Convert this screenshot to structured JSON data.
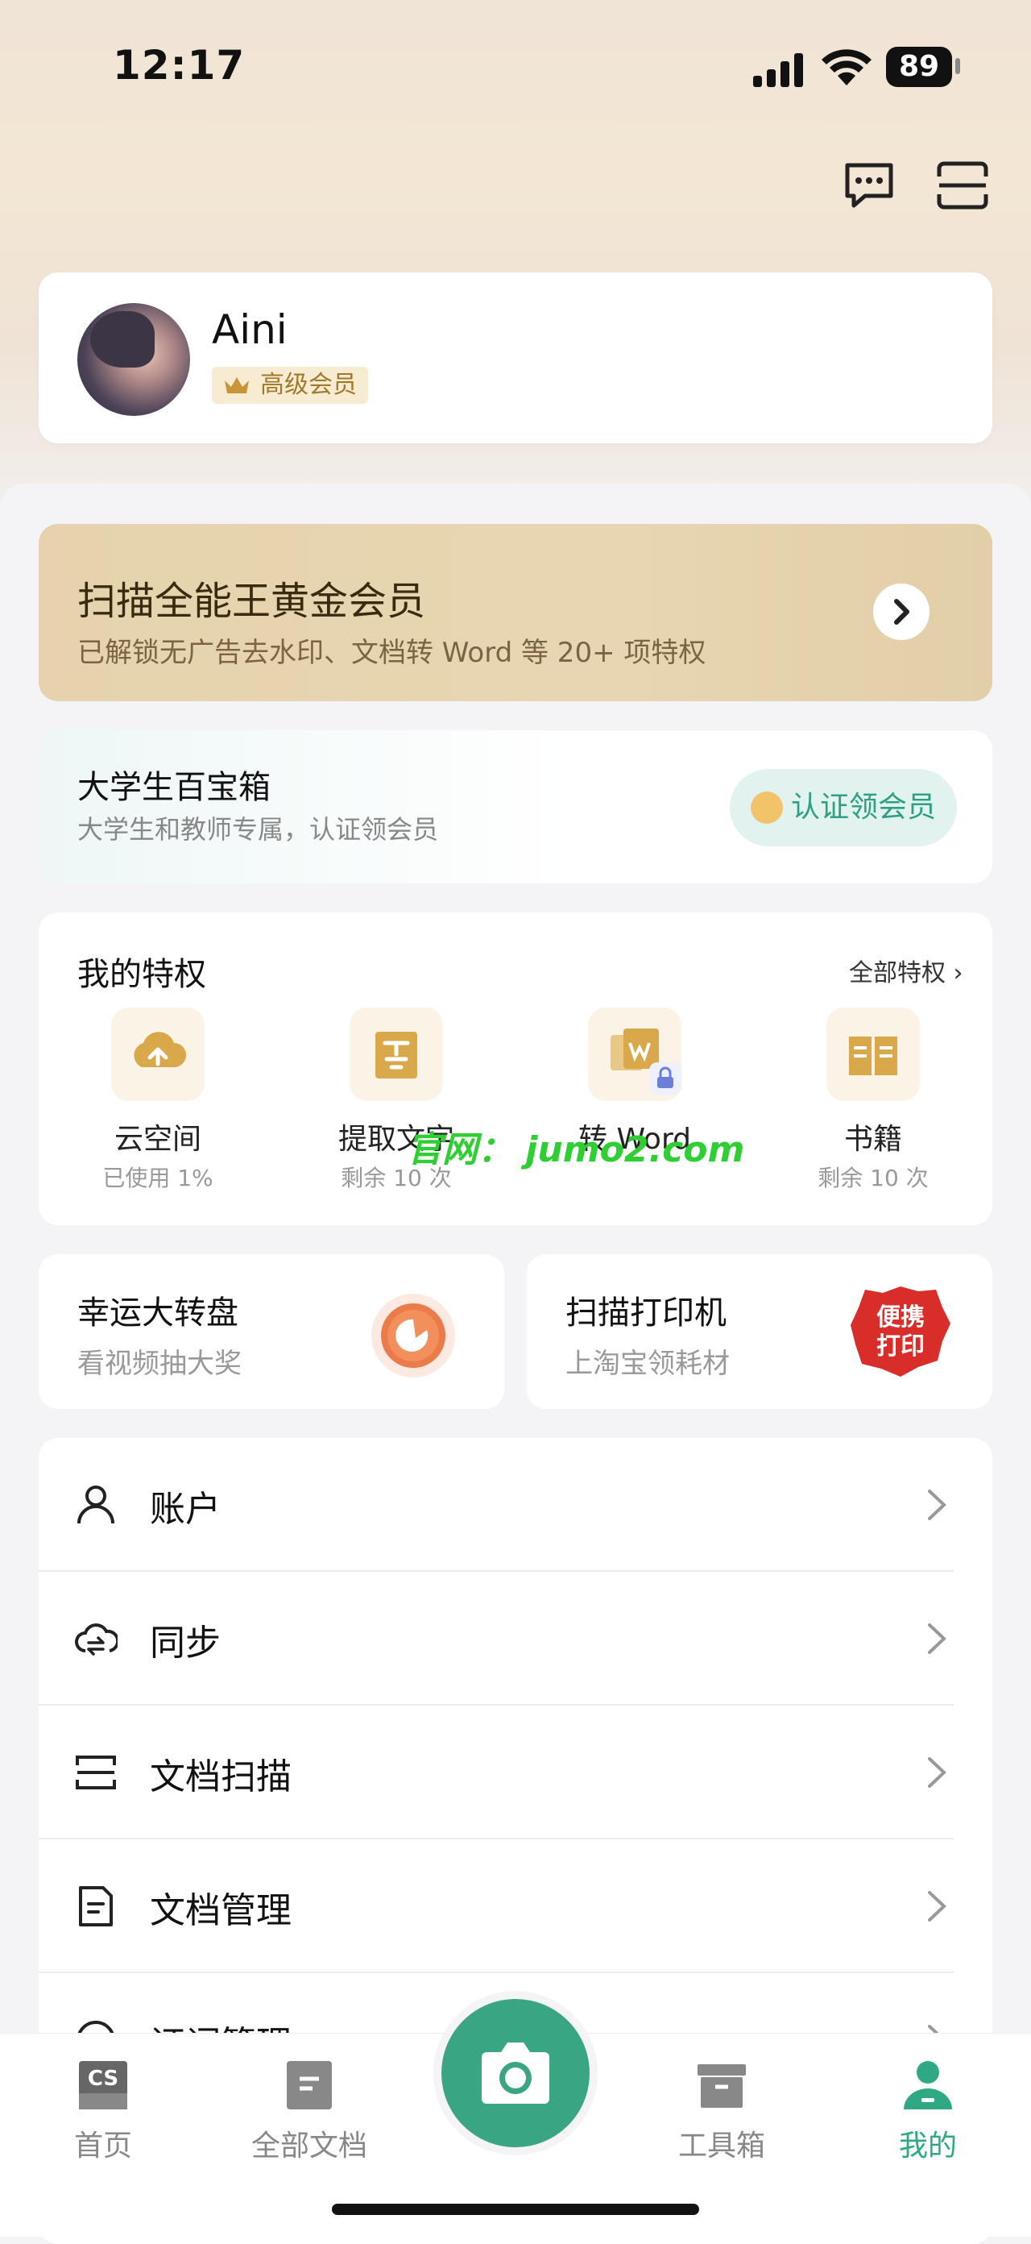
{
  "status_bar": {
    "time": "12:17",
    "battery": "89"
  },
  "header": {
    "message_icon": "chat-bubble-icon",
    "scan_icon": "scan-icon"
  },
  "profile": {
    "name": "Aini",
    "badge": "高级会员"
  },
  "gold_card": {
    "title": "扫描全能王黄金会员",
    "subtitle": "已解锁无广告去水印、文档转 Word 等 20+ 项特权"
  },
  "student_card": {
    "title": "大学生百宝箱",
    "subtitle": "大学生和教师专属，认证领会员",
    "button": "认证领会员"
  },
  "privileges": {
    "title": "我的特权",
    "all_link": "全部特权 ›",
    "items": [
      {
        "label": "云空间",
        "sub": "已使用 1%",
        "icon": "cloud-upload-icon"
      },
      {
        "label": "提取文字",
        "sub": "剩余 10 次",
        "icon": "text-extract-icon"
      },
      {
        "label": "转 Word",
        "sub": "",
        "icon": "word-convert-icon"
      },
      {
        "label": "书籍",
        "sub": "剩余 10 次",
        "icon": "book-icon"
      }
    ]
  },
  "watermark": "官网： jumo2.com",
  "promo": {
    "lucky": {
      "title": "幸运大转盘",
      "subtitle": "看视频抽大奖"
    },
    "printer": {
      "title": "扫描打印机",
      "subtitle": "上淘宝领耗材",
      "badge": "便携\n打印"
    }
  },
  "menu": [
    {
      "label": "账户",
      "icon": "user-icon"
    },
    {
      "label": "同步",
      "icon": "cloud-sync-icon"
    },
    {
      "label": "文档扫描",
      "icon": "scan-icon"
    },
    {
      "label": "文档管理",
      "icon": "document-icon"
    },
    {
      "label": "证词管理",
      "icon": "manage-icon"
    }
  ],
  "tabs": [
    {
      "label": "首页",
      "icon": "cs-logo-icon"
    },
    {
      "label": "全部文档",
      "icon": "folder-icon"
    },
    {
      "label": "工具箱",
      "icon": "toolbox-icon"
    },
    {
      "label": "我的",
      "icon": "profile-icon",
      "active": true
    }
  ],
  "colors": {
    "accent": "#3aa582",
    "gold": "#e6d3ad",
    "vip_text": "#a07a2c"
  }
}
